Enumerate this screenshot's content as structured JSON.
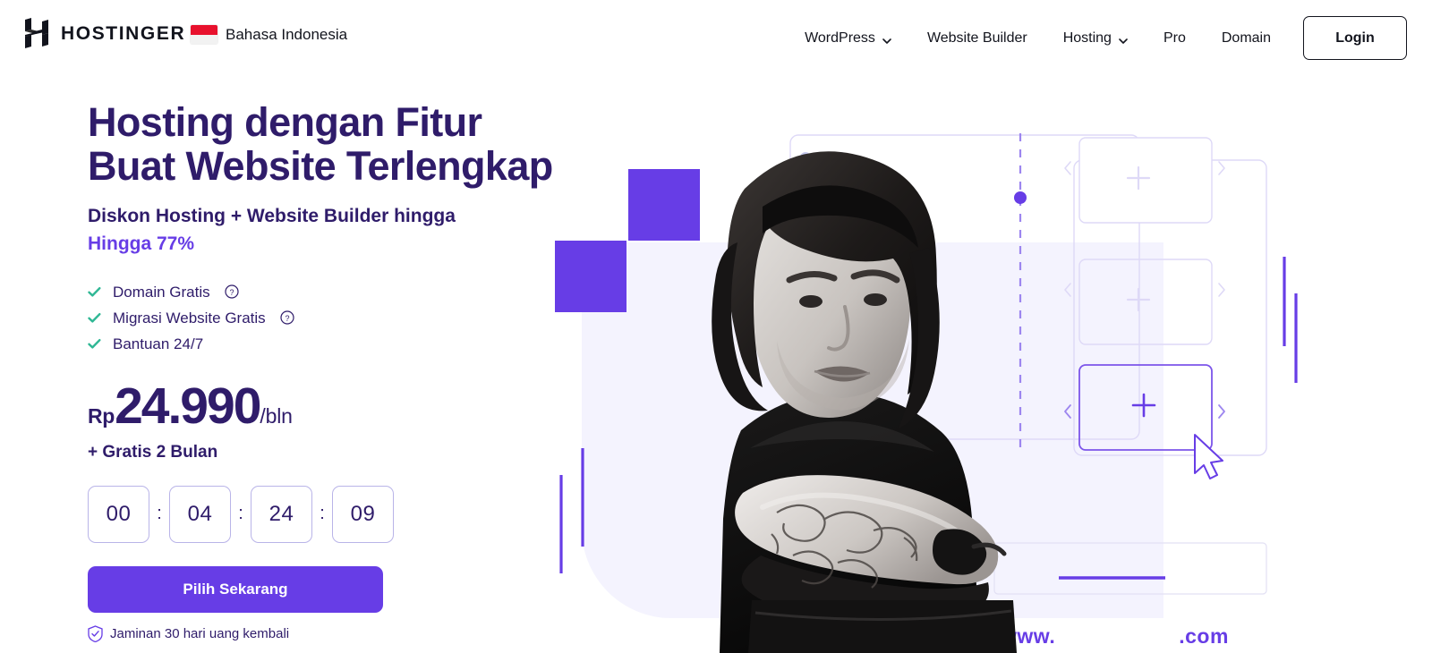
{
  "header": {
    "brand_name": "HOSTINGER",
    "language": "Bahasa Indonesia",
    "nav": [
      {
        "label": "WordPress",
        "has_caret": true
      },
      {
        "label": "Website Builder",
        "has_caret": false
      },
      {
        "label": "Hosting",
        "has_caret": true
      },
      {
        "label": "Pro",
        "has_caret": false
      },
      {
        "label": "Domain",
        "has_caret": false
      }
    ],
    "login_label": "Login"
  },
  "hero": {
    "headline": "Hosting dengan Fitur\nBuat Website Terlengkap",
    "subheadline": "Diskon Hosting + Website Builder hingga",
    "discount": "Hingga 77%",
    "features": [
      {
        "label": "Domain Gratis",
        "info": true
      },
      {
        "label": "Migrasi Website Gratis",
        "info": true
      },
      {
        "label": "Bantuan 24/7",
        "info": false
      }
    ],
    "price": {
      "currency": "Rp",
      "amount": "24.990",
      "period": "/bln",
      "bonus": "+ Gratis 2 Bulan"
    },
    "countdown": {
      "days": "00",
      "hours": "04",
      "minutes": "24",
      "seconds": "09",
      "separator": ":"
    },
    "cta_label": "Pilih Sekarang",
    "guarantee": "Jaminan 30 hari uang kembali",
    "domain_mock": {
      "prefix": "www.",
      "suffix": ".com"
    }
  },
  "colors": {
    "brand_purple": "#673de6",
    "headline_navy": "#2f1c6a",
    "check_green": "#2eb794",
    "lavender_bg": "#f4f3fe",
    "flag_red": "#e8112d",
    "text_dark": "#12141d"
  }
}
